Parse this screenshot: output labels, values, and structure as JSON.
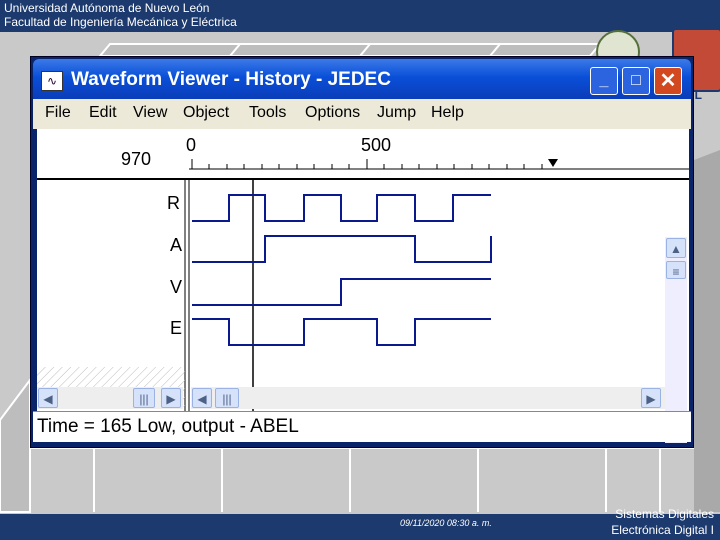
{
  "slide": {
    "header_line1": "Universidad Autónoma de Nuevo León",
    "header_line2": "Facultad de Ingeniería Mecánica y Eléctrica",
    "footer_date": "09/11/2020 08:30 a. m.",
    "footer_course": "Sistemas Digitales",
    "footer_program": "Electrónica Digital I",
    "uanl_text": "NL"
  },
  "window": {
    "title": "Waveform Viewer - History - JEDEC",
    "controls": {
      "minimize": "_",
      "maximize": "□",
      "close": "✕"
    }
  },
  "menu": [
    "File",
    "Edit",
    "View",
    "Object",
    "Tools",
    "Options",
    "Jump",
    "Help"
  ],
  "ruler": {
    "cursor_time": "970",
    "start_label": "0",
    "mid_label": "500"
  },
  "signals": [
    "R",
    "A",
    "V",
    "E"
  ],
  "status": "Time = 165 Low, output - ABEL",
  "icons": {
    "window": "waveform-app-icon",
    "scroll_left": "arrow-left-icon",
    "scroll_right": "arrow-right-icon",
    "scroll_up": "arrow-up-icon",
    "scroll_down": "arrow-down-icon",
    "marker": "triangle-down-icon"
  },
  "colors": {
    "title_bar": "#0a4fd8",
    "waveform": "#0a1a8c",
    "slide_band": "#1c3a6e"
  }
}
